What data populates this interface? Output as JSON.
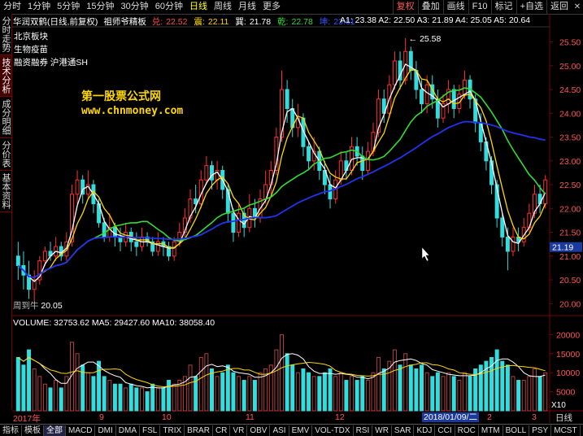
{
  "toolbar": {
    "periods": [
      "分时",
      "1分钟",
      "5分钟",
      "15分钟",
      "30分钟",
      "60分钟",
      "日线",
      "周线",
      "月线",
      "更多"
    ],
    "active_period": "日线",
    "right_buttons": [
      "复权",
      "叠加",
      "画线",
      "F10",
      "标记",
      "+自选",
      "返回"
    ]
  },
  "sidebar_tabs": [
    "分时走势",
    "技术分析",
    "成分明细",
    "分价表",
    "基本资料"
  ],
  "active_sidebar_tab": "技术分析",
  "header": {
    "stock_title": "华润双鹤(日线,前复权)",
    "indicator_name": "祖师爷精板",
    "values": [
      {
        "label": "兑:",
        "value": "22.52",
        "color": "#ff5050"
      },
      {
        "label": "震:",
        "value": "22.11",
        "color": "#ffd700"
      },
      {
        "label": "巽:",
        "value": "21.78",
        "color": "#ffffff"
      },
      {
        "label": "乾:",
        "value": "22.78",
        "color": "#33dd33"
      },
      {
        "label": "坤:",
        "value": "23.61",
        "color": "#3355ff"
      }
    ],
    "ma_values": "A1: 23.38  A2: 22.50  A3: 21.89  A4: 25.05  A5: 20.64"
  },
  "info_lines": [
    "北京板块",
    "生物疫苗",
    "融资融券 沪港通SH"
  ],
  "watermark": {
    "line1": "第一股票公式网",
    "line2": "www.chnmoney.com"
  },
  "annotations": {
    "high": "25.58",
    "low": "20.05",
    "low_prefix": "周到牛"
  },
  "price_axis": {
    "ticks": [
      "25.50",
      "25.00",
      "24.50",
      "24.00",
      "23.50",
      "23.00",
      "22.50",
      "22.00",
      "21.50",
      "21.00",
      "20.50",
      "20.00"
    ],
    "current": "21.19"
  },
  "volume": {
    "label": "VOLUME: 32753.62  MA5: 29427.60  MA10: 38058.40",
    "axis_ticks": [
      "20000",
      "15000",
      "10000",
      "5000"
    ],
    "unit": "X10"
  },
  "date_axis": {
    "labels": [
      "2017年",
      "9",
      "10",
      "11",
      "12",
      "2",
      "3"
    ],
    "cursor": "2018/01/09/二"
  },
  "right_footer": "日线",
  "bottom_tabs": [
    "指标",
    "模板",
    "全部",
    "MACD",
    "DMI",
    "DMA",
    "FSL",
    "TRIX",
    "BRAR",
    "CR",
    "VR",
    "OBV",
    "ASI",
    "EMV",
    "VOL-TDX",
    "RSI",
    "WR",
    "SAR",
    "KDJ",
    "CCI",
    "ROC",
    "MTM",
    "BOLL",
    "PSY",
    "MCST"
  ],
  "active_bottom_tab": "全部",
  "colors": {
    "up": "#ff3030",
    "down": "#33dddd",
    "ma_white": "#ffffff",
    "ma_yellow": "#ffd700",
    "ma_green": "#33dd33",
    "ma_blue": "#2233ee",
    "axis": "#7a0000"
  },
  "chart_data": {
    "type": "candlestick",
    "price_range": [
      19.8,
      25.8
    ],
    "volume_range": [
      0,
      22000
    ],
    "candles": [
      [
        21.0,
        20.8,
        21.3,
        20.5,
        14000
      ],
      [
        20.8,
        20.6,
        21.1,
        20.3,
        12000
      ],
      [
        20.6,
        20.3,
        20.9,
        20.1,
        16000
      ],
      [
        20.3,
        20.5,
        20.7,
        20.05,
        11000
      ],
      [
        20.5,
        20.9,
        21.0,
        20.4,
        9000
      ],
      [
        20.9,
        21.1,
        21.2,
        20.8,
        7000
      ],
      [
        21.1,
        21.0,
        21.3,
        20.9,
        6000
      ],
      [
        21.0,
        21.2,
        21.4,
        20.9,
        8000
      ],
      [
        21.2,
        21.0,
        21.3,
        20.9,
        6000
      ],
      [
        21.0,
        21.3,
        21.5,
        20.9,
        9000
      ],
      [
        21.3,
        22.3,
        22.5,
        21.2,
        18000
      ],
      [
        22.3,
        22.6,
        22.8,
        22.1,
        15000
      ],
      [
        22.6,
        22.3,
        22.7,
        22.1,
        12000
      ],
      [
        22.3,
        22.5,
        22.8,
        22.2,
        10000
      ],
      [
        22.5,
        22.1,
        22.6,
        21.9,
        9000
      ],
      [
        22.1,
        21.7,
        22.2,
        21.6,
        13000
      ],
      [
        21.7,
        21.4,
        21.8,
        21.3,
        9000
      ],
      [
        21.4,
        21.6,
        21.9,
        21.3,
        8000
      ],
      [
        21.6,
        21.4,
        21.7,
        21.2,
        7000
      ],
      [
        21.4,
        21.3,
        21.6,
        21.1,
        7000
      ],
      [
        21.3,
        21.5,
        21.7,
        21.2,
        6000
      ],
      [
        21.5,
        21.3,
        21.6,
        21.1,
        7000
      ],
      [
        21.3,
        21.2,
        21.5,
        21.0,
        6000
      ],
      [
        21.2,
        21.4,
        21.6,
        21.1,
        6000
      ],
      [
        21.4,
        21.3,
        21.5,
        21.2,
        5000
      ],
      [
        21.3,
        21.1,
        21.4,
        21.0,
        7000
      ],
      [
        21.1,
        21.3,
        21.5,
        21.0,
        6000
      ],
      [
        21.3,
        21.2,
        21.4,
        21.0,
        6000
      ],
      [
        21.2,
        21.0,
        21.3,
        20.9,
        8000
      ],
      [
        21.0,
        21.3,
        21.4,
        20.9,
        7000
      ],
      [
        21.3,
        21.5,
        21.7,
        21.2,
        8000
      ],
      [
        21.5,
        21.8,
        22.0,
        21.4,
        9000
      ],
      [
        21.8,
        22.2,
        22.4,
        21.7,
        12000
      ],
      [
        22.2,
        22.1,
        22.5,
        21.9,
        9000
      ],
      [
        22.1,
        22.6,
        22.8,
        22.0,
        14000
      ],
      [
        22.6,
        22.9,
        23.1,
        22.5,
        15000
      ],
      [
        22.9,
        22.6,
        23.0,
        22.4,
        11000
      ],
      [
        22.6,
        22.8,
        23.0,
        22.4,
        9000
      ],
      [
        22.8,
        22.4,
        22.9,
        22.2,
        10000
      ],
      [
        22.4,
        21.9,
        22.5,
        21.7,
        12000
      ],
      [
        21.9,
        21.5,
        22.0,
        21.3,
        10000
      ],
      [
        21.5,
        21.9,
        22.1,
        21.4,
        9000
      ],
      [
        21.9,
        21.6,
        22.0,
        21.4,
        8000
      ],
      [
        21.6,
        22.0,
        22.3,
        21.5,
        9000
      ],
      [
        22.0,
        21.8,
        22.2,
        21.6,
        8000
      ],
      [
        21.8,
        22.2,
        22.4,
        21.7,
        10000
      ],
      [
        22.2,
        22.5,
        22.8,
        22.1,
        11000
      ],
      [
        22.5,
        22.8,
        23.0,
        22.3,
        12000
      ],
      [
        22.8,
        23.5,
        23.7,
        22.7,
        16000
      ],
      [
        23.5,
        24.5,
        24.9,
        23.4,
        20000
      ],
      [
        24.5,
        24.1,
        24.7,
        23.8,
        15000
      ],
      [
        24.1,
        23.7,
        24.3,
        23.5,
        12000
      ],
      [
        23.7,
        23.9,
        24.2,
        23.5,
        10000
      ],
      [
        23.9,
        23.3,
        24.0,
        23.1,
        11000
      ],
      [
        23.3,
        23.0,
        23.4,
        22.8,
        10000
      ],
      [
        23.0,
        23.2,
        23.5,
        22.8,
        9000
      ],
      [
        23.2,
        22.8,
        23.3,
        22.6,
        9000
      ],
      [
        22.8,
        22.5,
        23.0,
        22.3,
        10000
      ],
      [
        22.5,
        22.2,
        22.7,
        22.0,
        11000
      ],
      [
        22.2,
        22.6,
        22.8,
        22.1,
        9000
      ],
      [
        22.6,
        23.0,
        23.2,
        22.5,
        10000
      ],
      [
        23.0,
        22.8,
        23.2,
        22.6,
        8000
      ],
      [
        22.8,
        23.3,
        23.5,
        22.7,
        9000
      ],
      [
        23.3,
        23.1,
        23.5,
        22.9,
        8000
      ],
      [
        23.1,
        22.8,
        23.3,
        22.6,
        9000
      ],
      [
        22.8,
        23.2,
        23.4,
        22.7,
        8000
      ],
      [
        23.2,
        23.6,
        23.8,
        23.1,
        10000
      ],
      [
        23.6,
        24.3,
        24.5,
        23.5,
        14000
      ],
      [
        24.3,
        24.0,
        24.5,
        23.8,
        11000
      ],
      [
        24.0,
        24.6,
        24.8,
        23.9,
        13000
      ],
      [
        24.6,
        25.1,
        25.3,
        24.5,
        16000
      ],
      [
        25.1,
        24.7,
        25.3,
        24.5,
        12000
      ],
      [
        24.7,
        25.3,
        25.58,
        24.6,
        15000
      ],
      [
        25.3,
        24.9,
        25.4,
        24.7,
        12000
      ],
      [
        24.9,
        24.5,
        25.1,
        24.3,
        11000
      ],
      [
        24.5,
        24.2,
        24.7,
        24.0,
        12000
      ],
      [
        24.2,
        24.6,
        24.8,
        24.0,
        10000
      ],
      [
        24.6,
        24.3,
        24.8,
        24.1,
        9000
      ],
      [
        24.3,
        23.9,
        24.5,
        23.7,
        10000
      ],
      [
        23.9,
        24.2,
        24.4,
        23.8,
        9000
      ],
      [
        24.2,
        24.5,
        24.7,
        24.0,
        10000
      ],
      [
        24.5,
        24.1,
        24.6,
        23.9,
        9000
      ],
      [
        24.1,
        24.4,
        24.6,
        24.0,
        8000
      ],
      [
        24.4,
        24.7,
        24.9,
        24.3,
        10000
      ],
      [
        24.7,
        24.3,
        24.8,
        24.1,
        9000
      ],
      [
        24.3,
        23.8,
        24.4,
        23.6,
        11000
      ],
      [
        23.8,
        23.4,
        24.0,
        23.2,
        12000
      ],
      [
        23.4,
        23.0,
        23.5,
        22.8,
        13000
      ],
      [
        23.0,
        22.5,
        23.1,
        22.3,
        14000
      ],
      [
        22.5,
        21.8,
        22.6,
        21.6,
        16000
      ],
      [
        21.8,
        21.4,
        21.9,
        21.2,
        13000
      ],
      [
        21.4,
        21.1,
        21.6,
        20.7,
        12000
      ],
      [
        21.1,
        21.4,
        21.6,
        21.0,
        9000
      ],
      [
        21.4,
        21.3,
        21.6,
        21.1,
        8000
      ],
      [
        21.3,
        21.6,
        21.8,
        21.2,
        8000
      ],
      [
        21.6,
        21.9,
        22.1,
        21.5,
        9000
      ],
      [
        21.9,
        22.3,
        22.5,
        21.8,
        11000
      ],
      [
        22.3,
        22.1,
        22.5,
        21.9,
        9000
      ],
      [
        22.1,
        22.6,
        22.7,
        22.0,
        10000
      ]
    ]
  }
}
